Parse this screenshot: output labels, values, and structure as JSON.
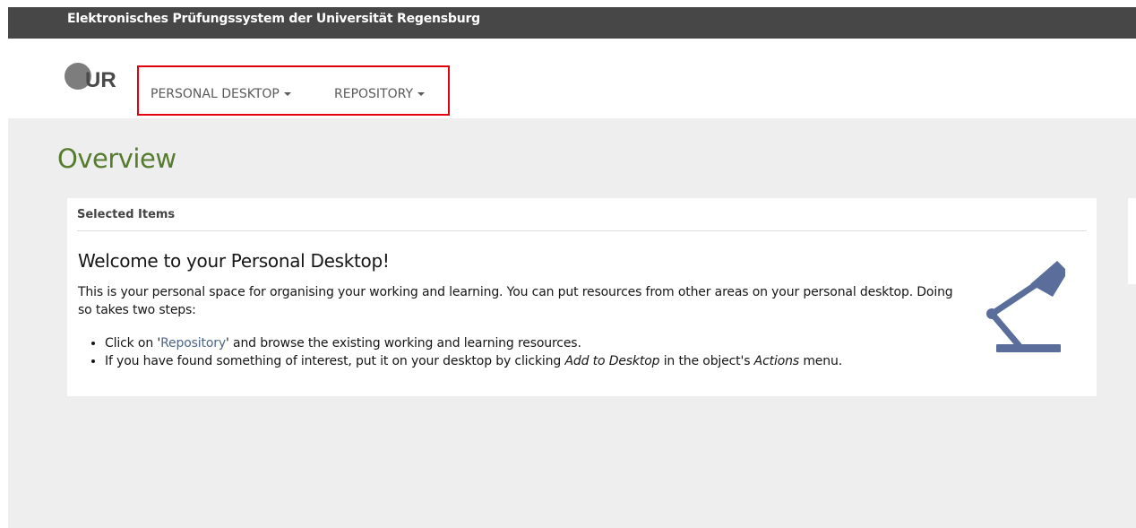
{
  "topbar": {
    "title": "Elektronisches Prüfungssystem der Universität Regensburg"
  },
  "logo": {
    "text": "UR"
  },
  "nav": {
    "items": [
      {
        "label": "PERSONAL DESKTOP"
      },
      {
        "label": "REPOSITORY"
      }
    ]
  },
  "page": {
    "title": "Overview"
  },
  "panel": {
    "header": "Selected Items",
    "welcome_title": "Welcome to your Personal Desktop!",
    "description": "This is your personal space for organising your working and learning. You can put resources from other areas on your personal desktop. Doing so takes two steps:",
    "step1": {
      "prefix": "Click on '",
      "link": "Repository",
      "suffix": "' and browse the existing working and learning resources."
    },
    "step2": {
      "prefix": "If you have found something of interest, put it on your desktop by clicking ",
      "em1": "Add to Desktop",
      "middle": " in the object's ",
      "em2": "Actions",
      "suffix": " menu."
    }
  },
  "colors": {
    "topbar": "#474747",
    "accent_green": "#557b2e",
    "highlight_red": "#e3000f",
    "lamp": "#5b6e9b",
    "link": "#4c6586"
  },
  "icons": {
    "logo": "university-logo-icon",
    "lamp": "desk-lamp-icon",
    "caret": "caret-down-icon"
  }
}
